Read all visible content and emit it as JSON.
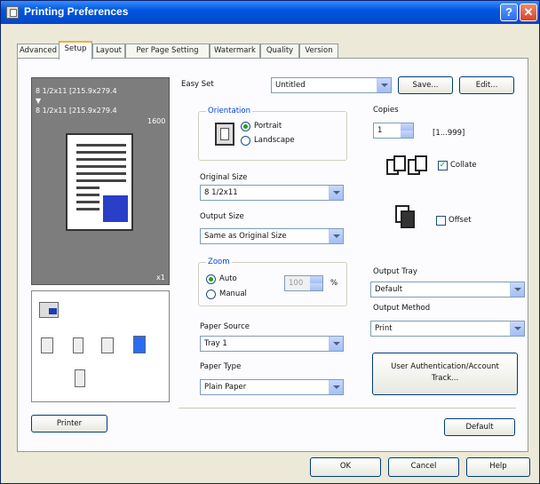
{
  "window": {
    "title": "Printing Preferences",
    "help_glyph": "?",
    "close_glyph": "✕"
  },
  "tabs": [
    "Advanced",
    "Setup",
    "Layout",
    "Per Page Setting",
    "Watermark",
    "Quality",
    "Version"
  ],
  "preview": {
    "line1": "8 1/2x11 [215.9x279.4",
    "arrow": "▼",
    "line2": "8 1/2x11 [215.9x279.4",
    "dpi": "1600",
    "copies": "x1"
  },
  "easy_set": {
    "label": "Easy Set",
    "value": "Untitled",
    "save": "Save...",
    "edit": "Edit..."
  },
  "orientation": {
    "group": "Orientation",
    "portrait": "Portrait",
    "landscape": "Landscape",
    "selected": "portrait"
  },
  "original_size": {
    "label": "Original Size",
    "value": "8 1/2x11"
  },
  "output_size": {
    "label": "Output Size",
    "value": "Same as Original Size"
  },
  "zoom": {
    "group": "Zoom",
    "auto": "Auto",
    "manual": "Manual",
    "value": "100",
    "unit": "%",
    "selected": "auto"
  },
  "paper_source": {
    "label": "Paper Source",
    "value": "Tray 1"
  },
  "paper_type": {
    "label": "Paper Type",
    "value": "Plain Paper"
  },
  "copies": {
    "label": "Copies",
    "value": "1",
    "range": "[1...999]"
  },
  "collate": {
    "label": "Collate",
    "checked": true,
    "mark": "✓"
  },
  "offset": {
    "label": "Offset",
    "checked": false
  },
  "output_tray": {
    "label": "Output Tray",
    "value": "Default"
  },
  "output_method": {
    "label": "Output Method",
    "value": "Print"
  },
  "user_auth_button": {
    "line1": "User Authentication/Account",
    "line2": "Track..."
  },
  "printer_button": "Printer",
  "default_button": "Default",
  "footer": {
    "ok": "OK",
    "cancel": "Cancel",
    "help": "Help"
  }
}
